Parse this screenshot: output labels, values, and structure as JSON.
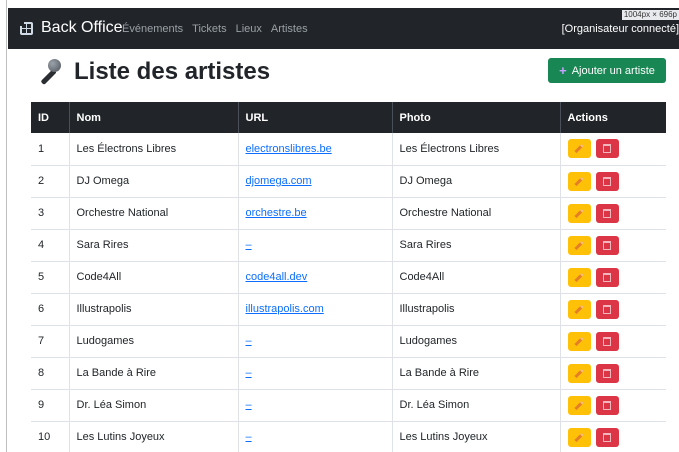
{
  "header": {
    "brand": "Back Office",
    "nav": [
      "Événements",
      "Tickets",
      "Lieux",
      "Artistes"
    ],
    "user": "[Organisateur connecté]",
    "viewport_badge": "1004px × 696p"
  },
  "page": {
    "title": "Liste des artistes",
    "add_button": "Ajouter un artiste"
  },
  "table": {
    "columns": [
      "ID",
      "Nom",
      "URL",
      "Photo",
      "Actions"
    ],
    "rows": [
      {
        "id": "1",
        "nom": "Les Électrons Libres",
        "url": "electronslibres.be",
        "photo": "Les Électrons Libres"
      },
      {
        "id": "2",
        "nom": "DJ Omega",
        "url": "djomega.com",
        "photo": "DJ Omega"
      },
      {
        "id": "3",
        "nom": "Orchestre National",
        "url": "orchestre.be",
        "photo": "Orchestre National"
      },
      {
        "id": "4",
        "nom": "Sara Rires",
        "url": "–",
        "photo": "Sara Rires"
      },
      {
        "id": "5",
        "nom": "Code4All",
        "url": "code4all.dev",
        "photo": "Code4All"
      },
      {
        "id": "6",
        "nom": "Illustrapolis",
        "url": "illustrapolis.com",
        "photo": "Illustrapolis"
      },
      {
        "id": "7",
        "nom": "Ludogames",
        "url": "–",
        "photo": "Ludogames"
      },
      {
        "id": "8",
        "nom": "La Bande à Rire",
        "url": "–",
        "photo": "La Bande à Rire"
      },
      {
        "id": "9",
        "nom": "Dr. Léa Simon",
        "url": "–",
        "photo": "Dr. Léa Simon"
      },
      {
        "id": "10",
        "nom": "Les Lutins Joyeux",
        "url": "–",
        "photo": "Les Lutins Joyeux"
      }
    ]
  },
  "icons": {
    "brand": "grid-icon",
    "title": "microphone-icon",
    "add": "plus-icon",
    "edit": "pencil-icon",
    "delete": "trash-icon"
  },
  "colors": {
    "navbar": "#212529",
    "add_button": "#198754",
    "edit_button": "#ffc107",
    "delete_button": "#dc3545",
    "link": "#0d6efd"
  }
}
